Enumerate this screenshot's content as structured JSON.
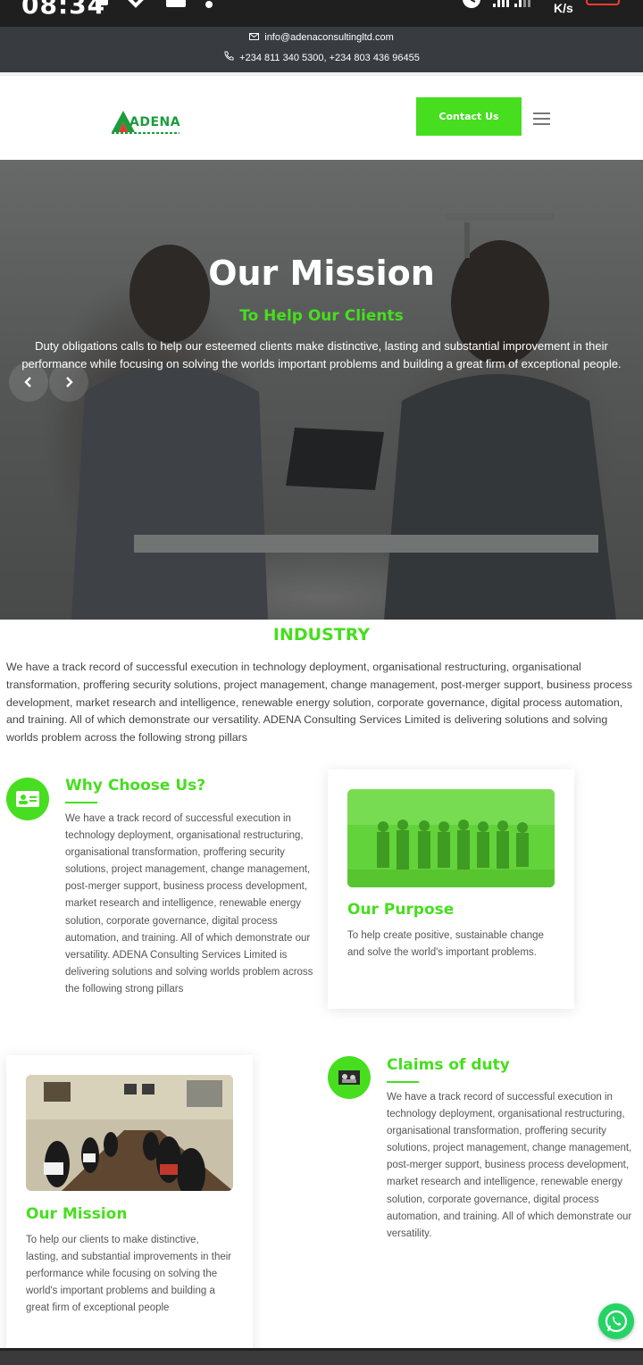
{
  "status_bar": {
    "time": "08:34",
    "network_unit": "K/s",
    "icons": [
      "notification-icon",
      "missed-call-icon",
      "message-icon",
      "dot-icon",
      "alarm-icon",
      "signal-icon",
      "battery-icon"
    ]
  },
  "contact_bar": {
    "email": "info@adenaconsultingltd.com",
    "phones": "+234 811 340 5300, +234 803 436 96455"
  },
  "header": {
    "logo_text": "ADENA",
    "contact_button": "Contact Us"
  },
  "hero": {
    "title": "Our Mission",
    "subtitle": "To Help Our Clients",
    "text": "Duty obligations calls to help our esteemed clients make distinctive, lasting and substantial improvement in their performance while focusing on solving the worlds important problems and building a great firm of exceptional people."
  },
  "industry": {
    "title": "INDUSTRY",
    "text": "We have a track record of successful execution in technology deployment, organisational restructuring, organisational transformation, proffering security solutions, project management, change management, post-merger support, business process development, market research and intelligence, renewable energy solution, corporate governance, digital process automation, and training. All of which demonstrate our versatility. ADENA Consulting Services Limited is delivering solutions and solving worlds problem across the following strong pillars"
  },
  "why_choose": {
    "title": "Why Choose Us?",
    "text": "We have a track record of successful execution in technology deployment, organisational restructuring, organisational transformation, proffering security solutions, project management, change management, post-merger support, business process development, market research and intelligence, renewable energy solution, corporate governance, digital process automation, and training. All of which demonstrate our versatility. ADENA Consulting Services Limited is delivering solutions and solving worlds problem across the following strong pillars"
  },
  "our_purpose": {
    "title": "Our Purpose",
    "text": "To help create positive, sustainable change and solve the world's important problems."
  },
  "claims_of_duty": {
    "title": "Claims of duty",
    "text": "We have a track record of successful execution in technology deployment, organisational restructuring, organisational transformation, proffering security solutions, project management, change management, post-merger support, business process development, market research and intelligence, renewable energy solution, corporate governance, digital process automation, and training. All of which demonstrate our versatility."
  },
  "our_mission": {
    "title": "Our Mission",
    "text": "To help our clients to make distinctive, lasting, and substantial improvements in their performance while focusing on solving the world's important problems and building a great firm of exceptional people"
  },
  "colors": {
    "accent_green": "#47de1f",
    "logo_green": "#1c9c3c",
    "contact_bar_bg": "#383b40",
    "whatsapp_green": "#25d366"
  }
}
